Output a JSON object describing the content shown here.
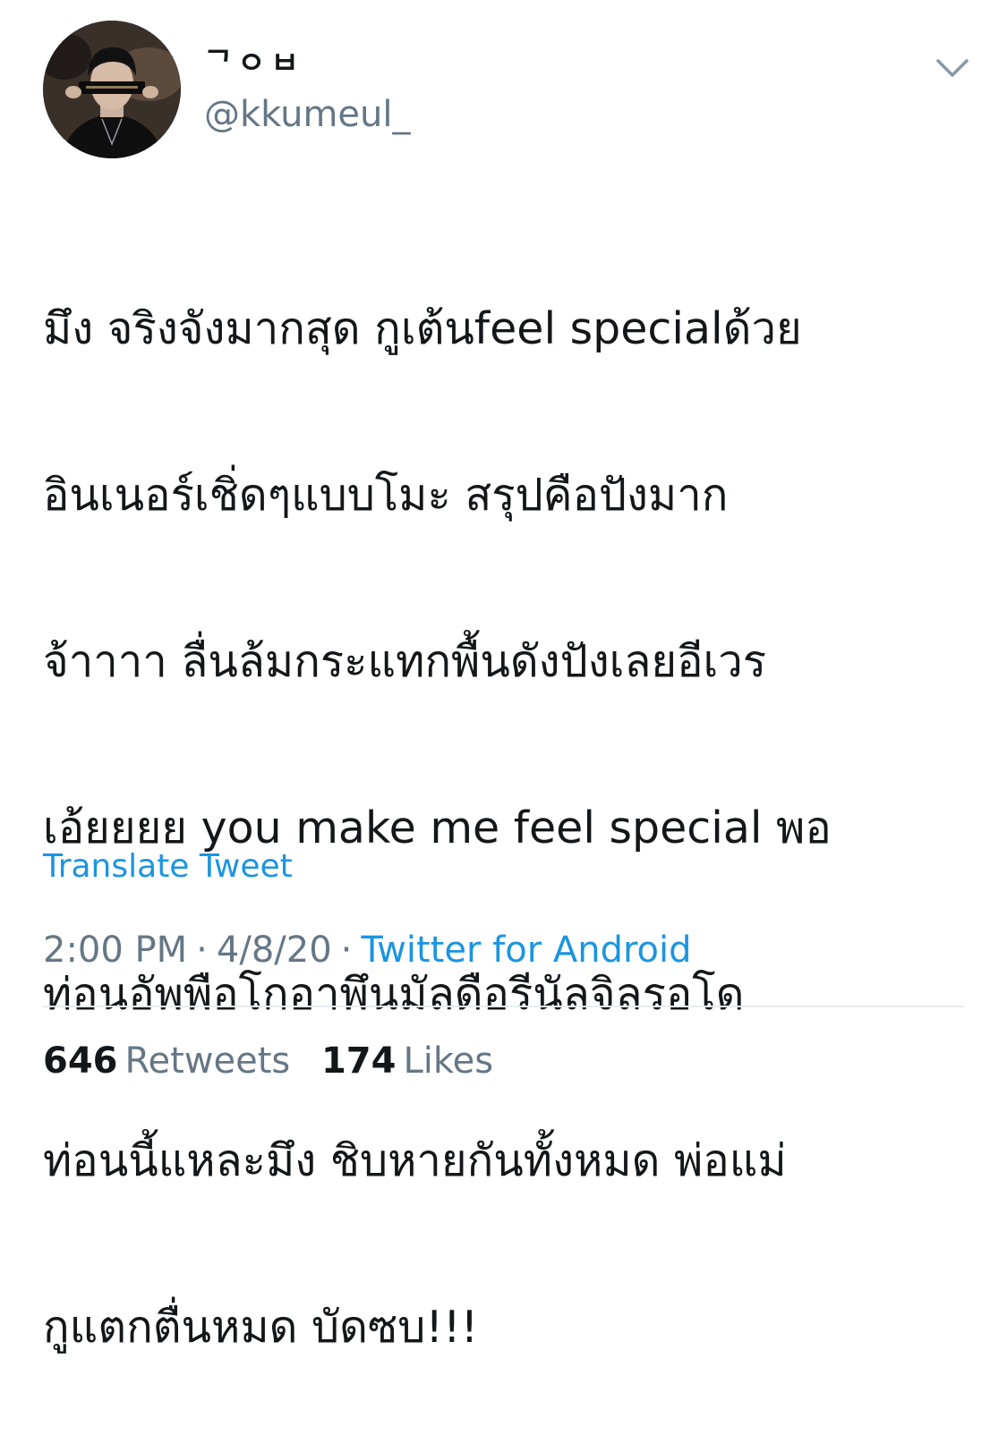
{
  "author": {
    "display_name": "ᄀㅇㅂ",
    "handle": "@kkumeul_"
  },
  "tweet": {
    "lines": [
      "มึง จริงจังมากสุด กูเต้นfeel specialด้วย",
      "อินเนอร์เชิ่ดๆแบบโมะ สรุปคือปังมาก",
      "จ้าาาา ลื่นล้มกระแทกพื้นดังปังเลยอีเวร",
      "เอ้ยยยย you make me feel special พอ",
      "ท่อนอัพพือโกอาพึนมัลดือรีนัลจิลรอโด",
      "ท่อนนี้แหละมึง ชิบหายกันทั้งหมด พ่อแม่",
      "กูแตกตื่นหมด บัดซบ!!!"
    ],
    "translate_label": "Translate Tweet",
    "time": "2:00 PM",
    "date": "4/8/20",
    "separator": "·",
    "source": "Twitter for Android"
  },
  "stats": {
    "retweets_count": "646",
    "retweets_label": "Retweets",
    "likes_count": "174",
    "likes_label": "Likes"
  },
  "icons": {
    "caret": "chevron-down-icon"
  },
  "colors": {
    "text": "#14171a",
    "secondary": "#657786",
    "link": "#1b95e0",
    "divider": "#e6ecf0"
  }
}
